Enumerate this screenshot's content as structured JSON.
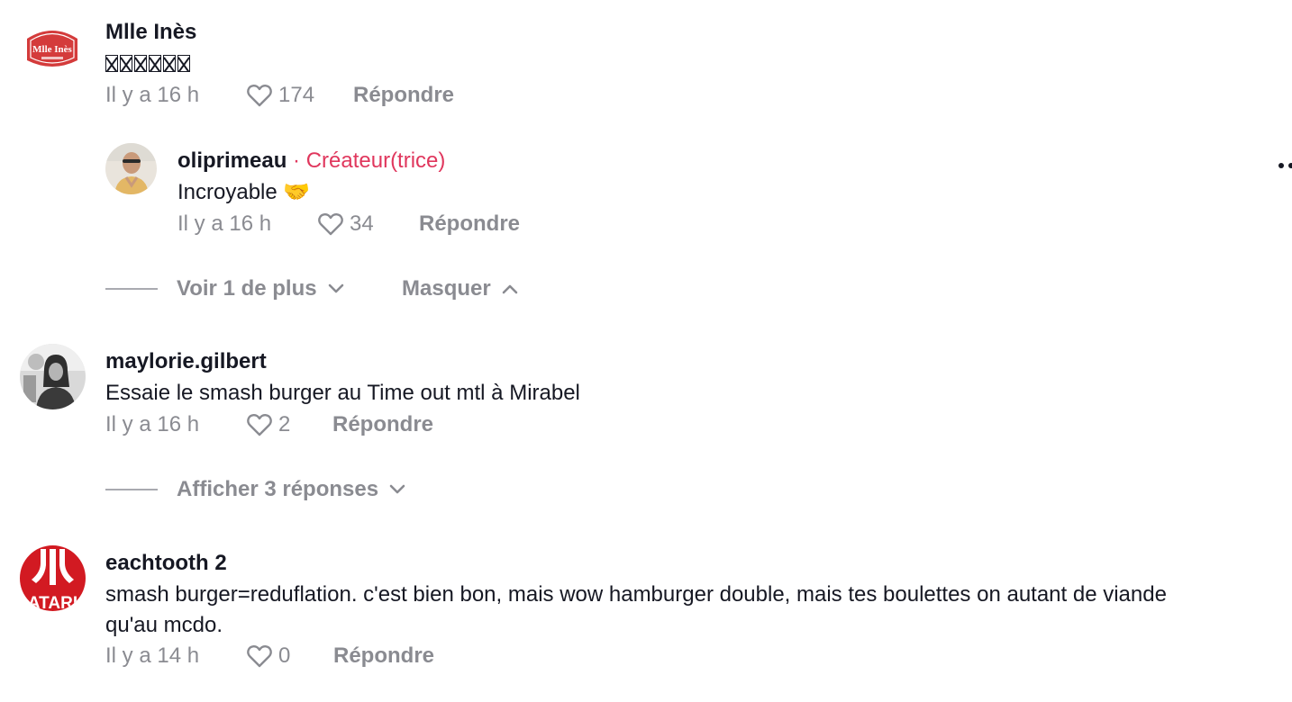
{
  "comments": [
    {
      "username": "Mlle Inès",
      "avatar_icon": "mlle-ines-logo",
      "avatar_text": "Mlle Inès",
      "text": "",
      "unrendered_glyph_count": 6,
      "time": "Il y a 16 h",
      "likes": "174",
      "reply_label": "Répondre",
      "replies": [
        {
          "username": "oliprimeau",
          "badge": "· Créateur(trice)",
          "avatar_icon": "user-photo",
          "text": "Incroyable 🤝",
          "time": "Il y a 16 h",
          "likes": "34",
          "reply_label": "Répondre"
        }
      ],
      "more_label": "Voir 1 de plus",
      "hide_label": "Masquer"
    },
    {
      "username": "maylorie.gilbert",
      "avatar_icon": "user-photo",
      "text": "Essaie le smash burger au Time out mtl à Mirabel",
      "time": "Il y a 16 h",
      "likes": "2",
      "reply_label": "Répondre",
      "show_replies_label": "Afficher 3 réponses"
    },
    {
      "username": "eachtooth 2",
      "avatar_icon": "atari-logo",
      "avatar_text": "ATARI",
      "text_line1": "smash burger=reduflation. c'est bien bon, mais wow hamburger double, mais tes boulettes on autant de viande",
      "text_line2": "qu'au mcdo.",
      "time": "Il y a 14 h",
      "likes": "0",
      "reply_label": "Répondre"
    }
  ],
  "colors": {
    "creator_badge": "#e0375d",
    "muted": "#8a8b91",
    "primary_text": "#161823"
  }
}
